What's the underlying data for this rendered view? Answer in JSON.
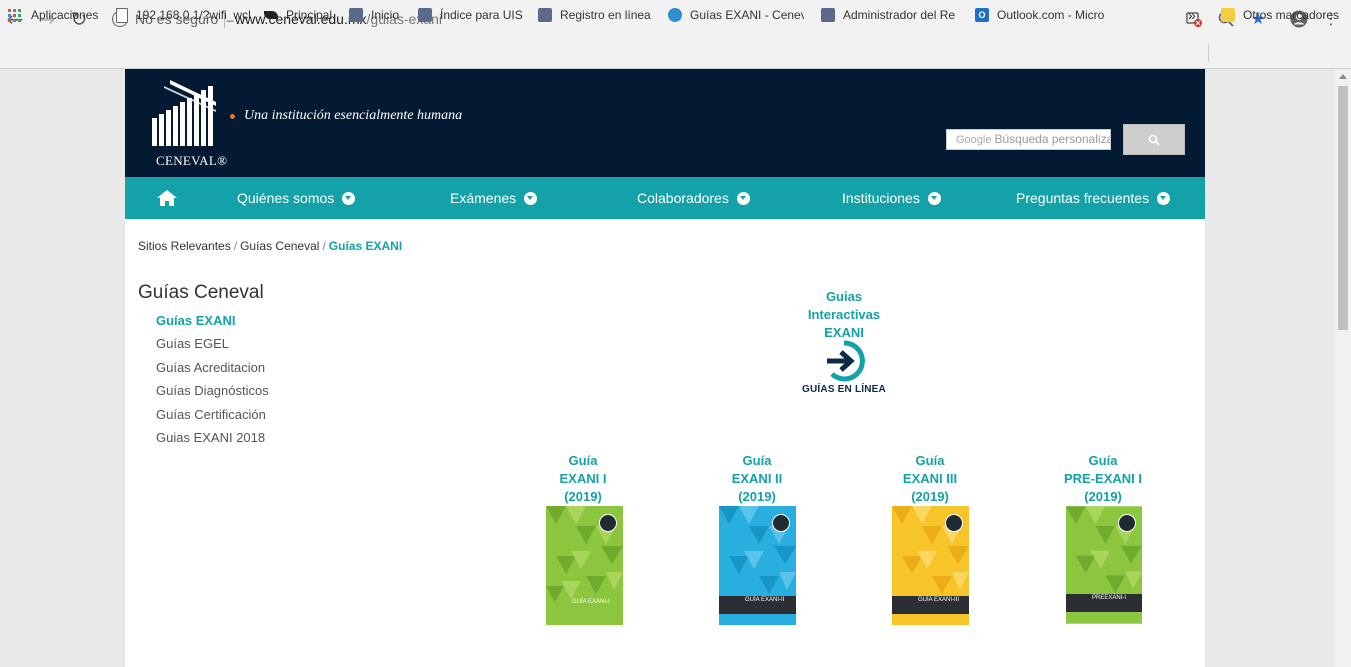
{
  "browser": {
    "security_label": "No es seguro",
    "url_host": "www.ceneval.edu.mx",
    "url_path": "/guias-exani",
    "bookmarks": [
      {
        "label": "Aplicaciones",
        "icon": "apps-grid-icon"
      },
      {
        "label": "192.168.0.1/?wifi_wcl",
        "icon": "page-icon"
      },
      {
        "label": "Principal",
        "icon": "bird-logo-icon"
      },
      {
        "label": "Inicio",
        "icon": "logo-icon"
      },
      {
        "label": "Índice para UIS",
        "icon": "logo-icon"
      },
      {
        "label": "Registro en línea",
        "icon": "logo-icon"
      },
      {
        "label": "Guías EXANI - Cenev",
        "icon": "logo-icon"
      },
      {
        "label": "Administrador del Re",
        "icon": "logo-icon"
      },
      {
        "label": "Outlook.com - Micro",
        "icon": "outlook-icon"
      }
    ],
    "more_bookmarks": "»",
    "other_bookmarks": "Otros marcadores"
  },
  "site": {
    "logo_text": "CENEVAL®",
    "tagline": "Una institución esencialmente humana",
    "search_brand": "Google",
    "search_placeholder": "Búsqueda personalizada",
    "nav": [
      {
        "label": "Quiénes somos"
      },
      {
        "label": "Exámenes"
      },
      {
        "label": "Colaboradores"
      },
      {
        "label": "Instituciones"
      },
      {
        "label": "Preguntas frecuentes"
      }
    ]
  },
  "breadcrumb": {
    "items": [
      "Sitios Relevantes",
      "Guías Ceneval",
      "Guías EXANI"
    ],
    "separator": "/"
  },
  "sidebar": {
    "title": "Guías Ceneval",
    "items": [
      {
        "label": "Guías EXANI",
        "active": true
      },
      {
        "label": "Guías EGEL"
      },
      {
        "label": "Guías Acreditacion"
      },
      {
        "label": "Guías Diagnósticos"
      },
      {
        "label": "Guías Certificación"
      },
      {
        "label": "Guias EXANI 2018"
      }
    ]
  },
  "interactive": {
    "lines": [
      "Guias",
      "Interactivas",
      "EXANI"
    ],
    "button_text": "GUÍAS EN LÍNEA"
  },
  "guides": [
    {
      "lines": [
        "Guía",
        "EXANI I",
        "(2019)"
      ],
      "cover_label": "GUÍA EXANI-I",
      "color": "#8cc63f"
    },
    {
      "lines": [
        "Guía",
        "EXANI II",
        "(2019)"
      ],
      "cover_label": "GUÍA EXANI-II",
      "color": "#29aee0"
    },
    {
      "lines": [
        "Guía",
        "EXANI III",
        "(2019)"
      ],
      "cover_label": "GUÍA EXANI-III",
      "color": "#f7c52a"
    },
    {
      "lines": [
        "Guía",
        "PRE-EXANI I",
        "(2019)"
      ],
      "cover_label": "PREEXANI-I",
      "color": "#8cc63f"
    }
  ],
  "colors": {
    "header_bg": "#041a33",
    "nav_bg": "#14a1a8",
    "accent": "#14a1a8"
  }
}
